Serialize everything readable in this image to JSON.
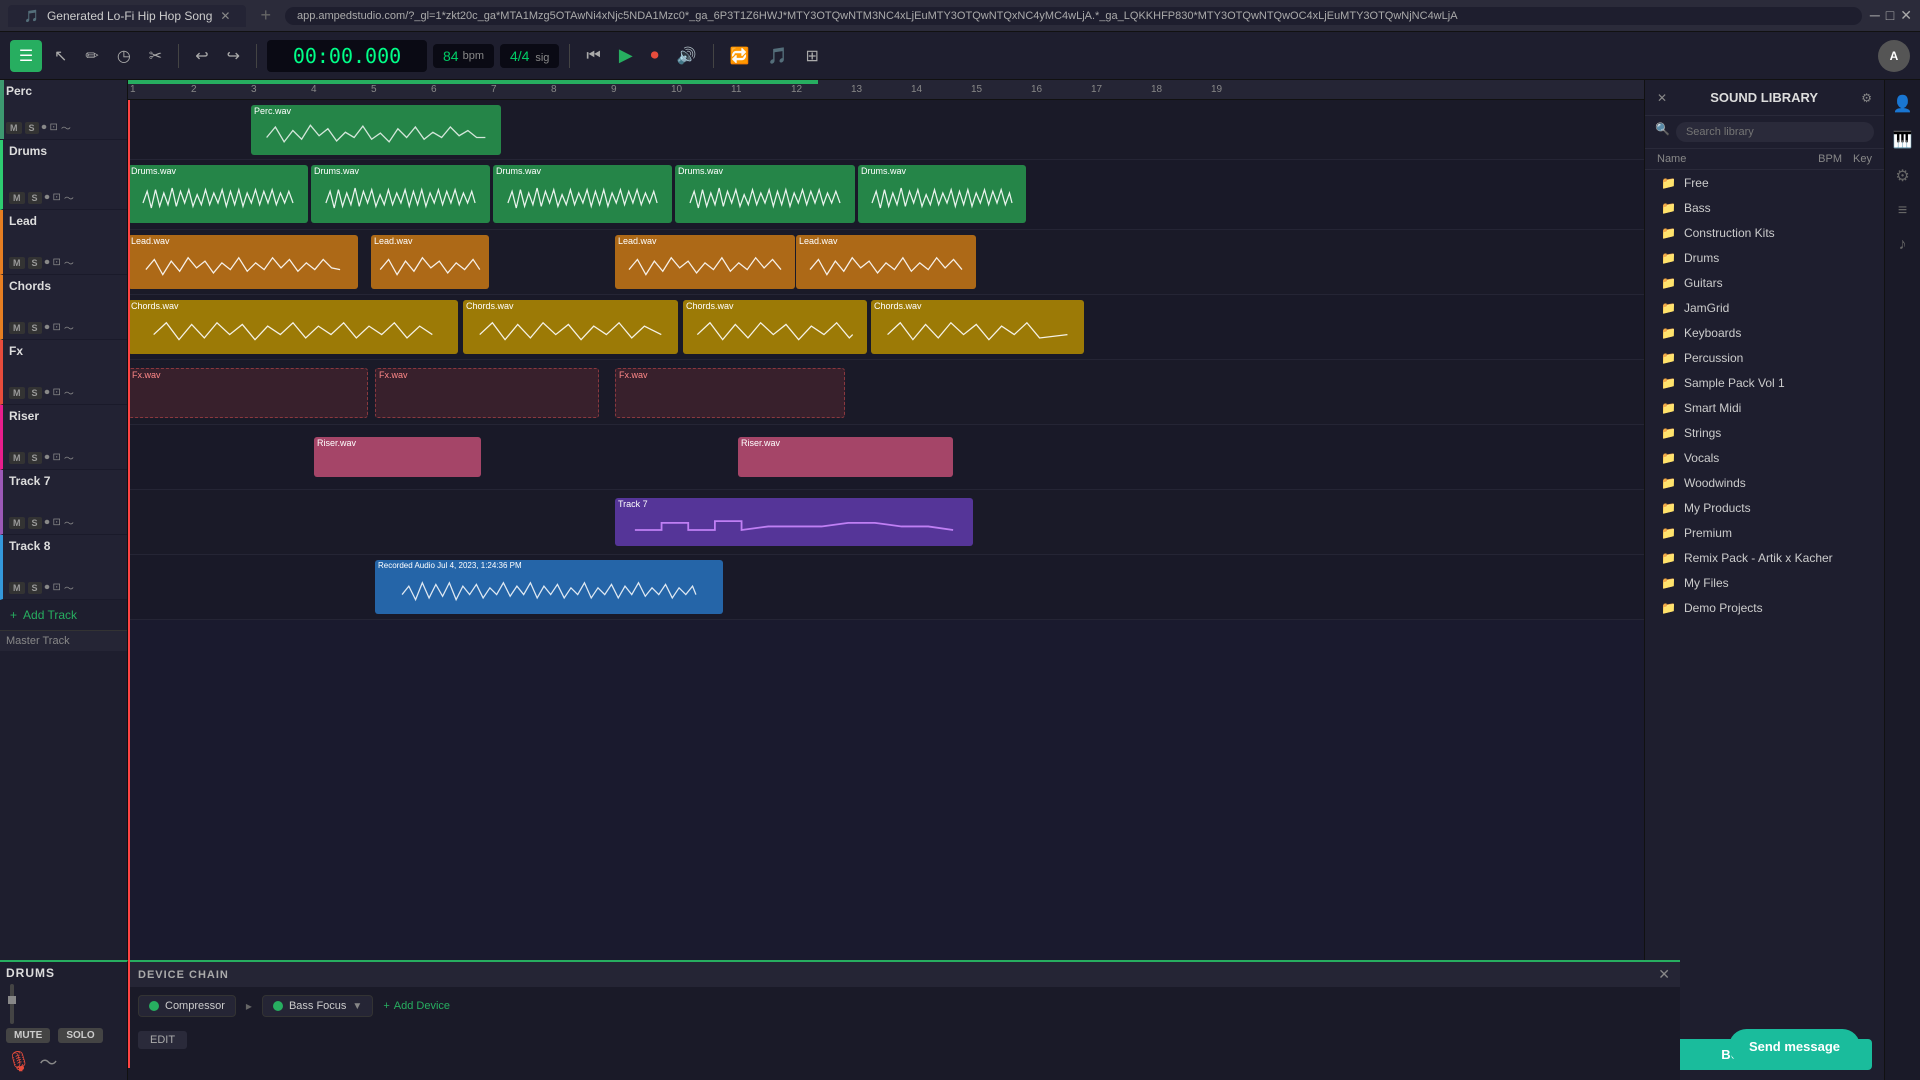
{
  "browser": {
    "tab_title": "Generated Lo-Fi Hip Hop Song",
    "url": "app.ampedstudio.com/?_gl=1*zkt20c_ga*MTA1Mzg5OTAwNi4xNjc5NDA1Mzc0*_ga_6P3T1Z6HWJ*MTY3OTQwNTM3NC4xLjEuMTY3OTQwNTQxNC4yMC4wLjA.*_ga_LQKKHFP830*MTY3OTQwNTQwOC4xLjEuMTY3OTQwNjNC4wLjA"
  },
  "toolbar": {
    "time": "00:00.000",
    "bpm": "84",
    "bpm_label": "bpm",
    "sig": "4/4",
    "sig_label": "sig"
  },
  "tracks": [
    {
      "id": 0,
      "name": "Perc",
      "color": "#3d9970",
      "type": "perc"
    },
    {
      "id": 1,
      "name": "Drums",
      "color": "#2ecc71",
      "type": "drums"
    },
    {
      "id": 2,
      "name": "Lead",
      "color": "#e67e22",
      "type": "lead"
    },
    {
      "id": 3,
      "name": "Chords",
      "color": "#e67e22",
      "type": "chords"
    },
    {
      "id": 4,
      "name": "Fx",
      "color": "#e74c3c",
      "type": "fx"
    },
    {
      "id": 5,
      "name": "Riser",
      "color": "#e91e8c",
      "type": "riser"
    },
    {
      "id": 6,
      "name": "Track 7",
      "color": "#9b59b6",
      "type": "midi"
    },
    {
      "id": 7,
      "name": "Track 8",
      "color": "#3498db",
      "type": "audio"
    }
  ],
  "add_track_label": "Add Track",
  "master_track_label": "Master Track",
  "library": {
    "title": "SOUND LIBRARY",
    "search_placeholder": "Search library",
    "col_name": "Name",
    "col_bpm": "BPM",
    "col_key": "Key",
    "items": [
      {
        "name": "Free",
        "type": "folder"
      },
      {
        "name": "Bass",
        "type": "folder"
      },
      {
        "name": "Construction Kits",
        "type": "folder"
      },
      {
        "name": "Drums",
        "type": "folder"
      },
      {
        "name": "Guitars",
        "type": "folder"
      },
      {
        "name": "JamGrid",
        "type": "folder"
      },
      {
        "name": "Keyboards",
        "type": "folder"
      },
      {
        "name": "Percussion",
        "type": "folder"
      },
      {
        "name": "Sample Pack Vol 1",
        "type": "folder"
      },
      {
        "name": "Smart Midi",
        "type": "folder"
      },
      {
        "name": "Strings",
        "type": "folder"
      },
      {
        "name": "Vocals",
        "type": "folder"
      },
      {
        "name": "Woodwinds",
        "type": "folder"
      },
      {
        "name": "My Products",
        "type": "folder"
      },
      {
        "name": "Premium",
        "type": "folder"
      },
      {
        "name": "Remix Pack - Artik x Kacher",
        "type": "folder"
      },
      {
        "name": "My Files",
        "type": "folder"
      },
      {
        "name": "Demo Projects",
        "type": "folder"
      }
    ],
    "buy_sounds_label": "BUY SOUNDS"
  },
  "device_chain": {
    "title": "DEVICE CHAIN",
    "devices": [
      {
        "name": "Compressor",
        "active": true
      },
      {
        "name": "Bass Focus",
        "active": true
      }
    ],
    "add_device_label": "Add Device",
    "edit_label": "EDIT"
  },
  "bottom_panel": {
    "label": "DRUMS",
    "mute_label": "MUTE",
    "solo_label": "SOLO"
  },
  "ruler_marks": [
    "1",
    "2",
    "3",
    "4",
    "5",
    "6",
    "7",
    "8",
    "9",
    "10",
    "11",
    "12",
    "13",
    "14",
    "15",
    "16",
    "17",
    "18",
    "19"
  ],
  "send_message_label": "Send message"
}
